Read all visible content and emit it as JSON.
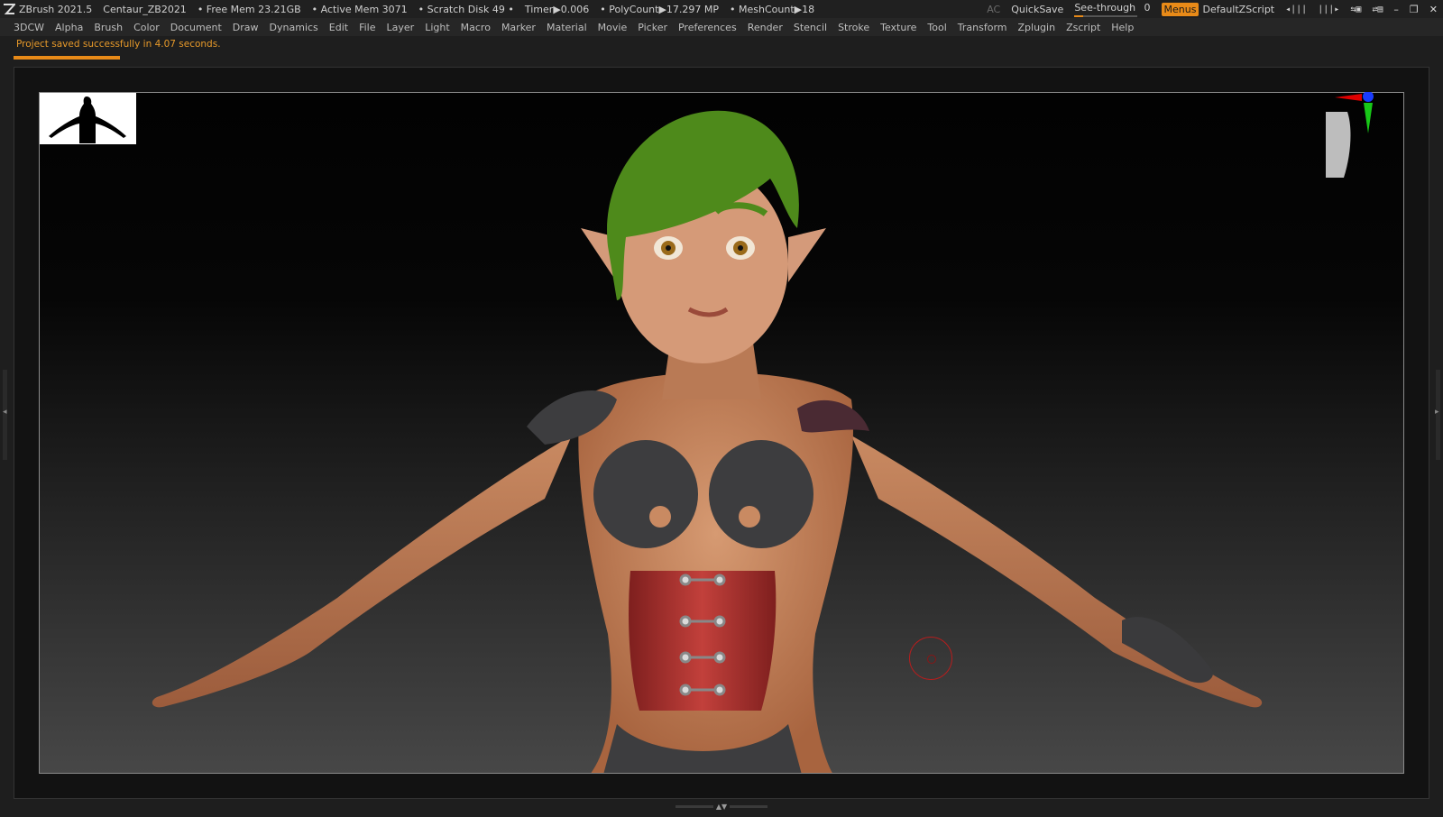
{
  "titlebar": {
    "app": "ZBrush 2021.5",
    "project": "Centaur_ZB2021",
    "free_mem": "• Free Mem 23.21GB",
    "active_mem": "• Active Mem 3071",
    "scratch": "• Scratch Disk 49 •",
    "timer": "Timer▶0.006",
    "polycount": "• PolyCount▶17.297 MP",
    "meshcount": "• MeshCount▶18",
    "ac": "AC",
    "quicksave": "QuickSave",
    "see_through_label": "See-through",
    "see_through_value": "0",
    "see_through_level": 0,
    "menus": "Menus",
    "script": "DefaultZScript"
  },
  "menu": [
    "3DCW",
    "Alpha",
    "Brush",
    "Color",
    "Document",
    "Draw",
    "Dynamics",
    "Edit",
    "File",
    "Layer",
    "Light",
    "Macro",
    "Marker",
    "Material",
    "Movie",
    "Picker",
    "Preferences",
    "Render",
    "Stencil",
    "Stroke",
    "Texture",
    "Tool",
    "Transform",
    "Zplugin",
    "Zscript",
    "Help"
  ],
  "notification": "Project saved successfully in 4.07 seconds.",
  "colors": {
    "accent": "#e88a18",
    "hair": "#4e8a1b",
    "skin": "#c98a62",
    "corset": "#b8302e",
    "armor": "#3d3d3f",
    "cursor": "#b81d1d"
  },
  "icons": {
    "logo": "zbrush-logo-icon",
    "nav": "navigation-head-icon",
    "cursor": "brush-cursor-icon"
  }
}
